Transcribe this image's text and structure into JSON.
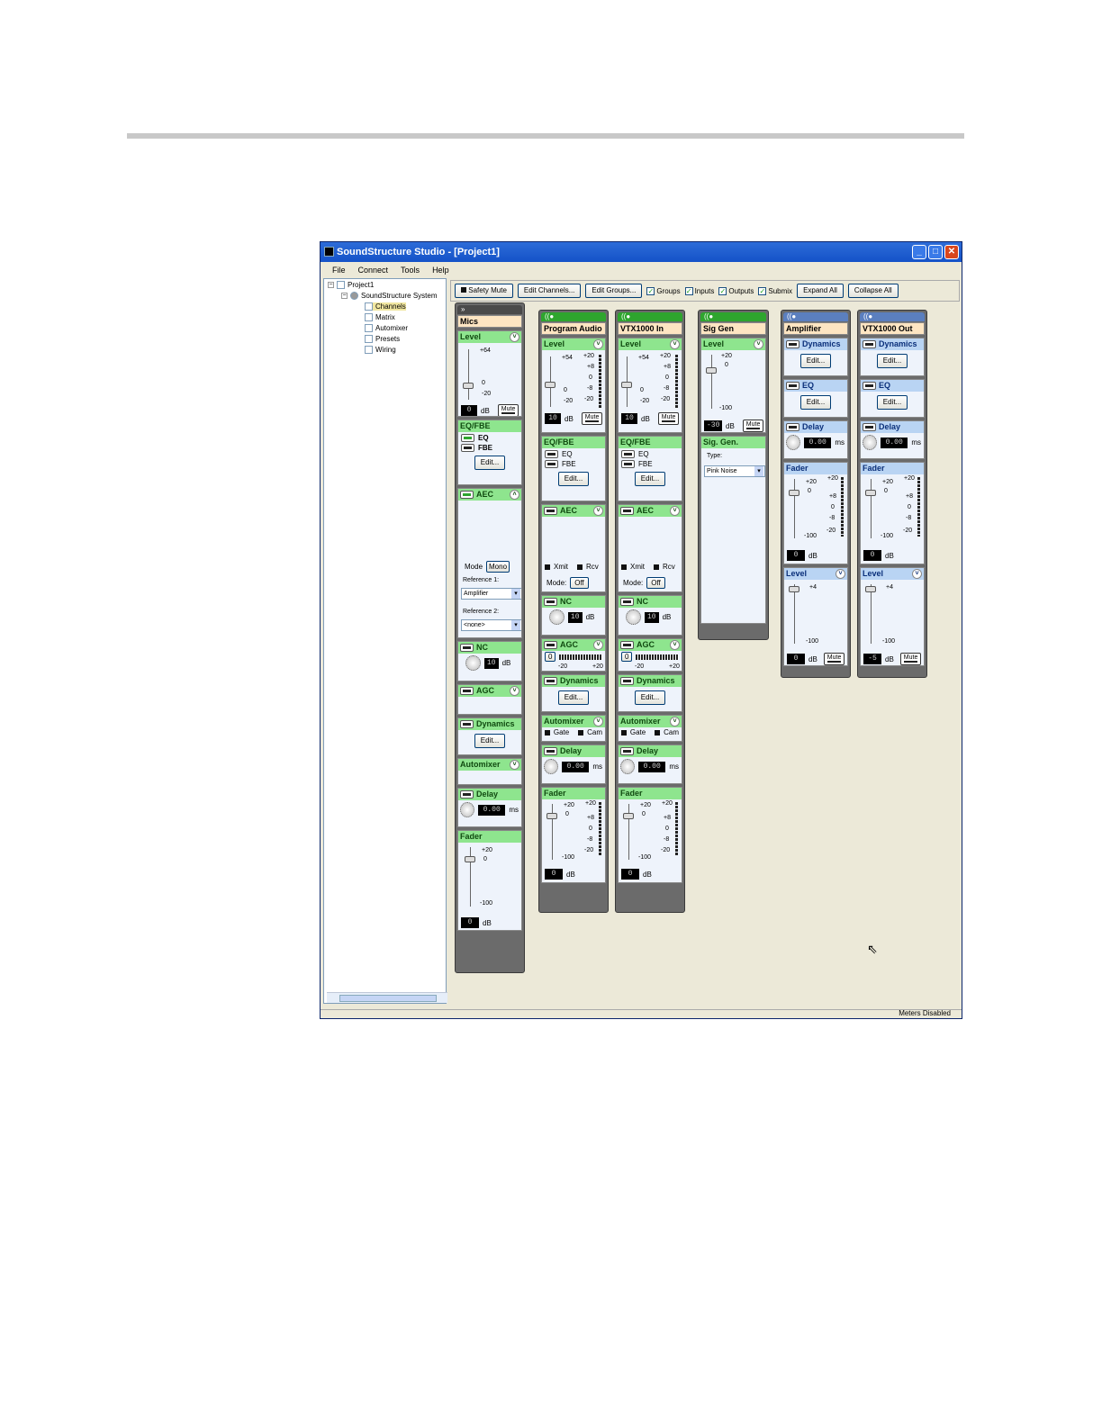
{
  "window": {
    "title": "SoundStructure Studio - [Project1]",
    "menu": [
      "File",
      "Connect",
      "Tools",
      "Help"
    ]
  },
  "tree": {
    "project": "Project1",
    "system": "SoundStructure System",
    "children": [
      "Channels",
      "Matrix",
      "Automixer",
      "Presets",
      "Wiring"
    ]
  },
  "toolbar": {
    "safety_mute": "Safety Mute",
    "edit_channels": "Edit Channels...",
    "edit_groups": "Edit Groups...",
    "checks": [
      "Groups",
      "Inputs",
      "Outputs",
      "Submix"
    ],
    "expand_all": "Expand All",
    "collapse_all": "Collapse All"
  },
  "status": "Meters Disabled",
  "common": {
    "db": "dB",
    "ms": "ms",
    "mute": "Mute",
    "edit": "Edit...",
    "level": "Level",
    "eqfbe": "EQ/FBE",
    "eq": "EQ",
    "fbe": "FBE",
    "aec": "AEC",
    "nc": "NC",
    "agc": "AGC",
    "dynamics": "Dynamics",
    "automixer": "Automixer",
    "delay": "Delay",
    "fader": "Fader",
    "xmit": "Xmit",
    "rcv": "Rcv",
    "gate": "Gate",
    "cam": "Cam",
    "mode": "Mode:",
    "off": "Off",
    "meter_ticks": [
      "+20",
      "+8",
      "0",
      "-8",
      "-20"
    ]
  },
  "mics": {
    "name": "Mics",
    "level": {
      "max": "+64",
      "zero": "0",
      "min": "-20",
      "value": "0"
    },
    "aec": {
      "mode_label": "Mode",
      "mode": "Mono",
      "ref1_label": "Reference 1:",
      "ref1": "Amplifier",
      "ref2_label": "Reference 2:",
      "ref2": "<none>"
    },
    "nc": "10",
    "delay": "0.00",
    "fader": {
      "max": "+20",
      "zero": "0",
      "min": "-100",
      "value": "0"
    }
  },
  "program": {
    "name": "Program Audio",
    "level": {
      "max": "+54",
      "zero": "0",
      "min": "-20",
      "value": "10"
    },
    "nc": "10",
    "agc": {
      "value": "0",
      "min": "-20",
      "max": "+20"
    },
    "delay": "0.00",
    "fader": {
      "max": "+20",
      "zero": "0",
      "min": "-100",
      "value": "0"
    }
  },
  "vtxin": {
    "name": "VTX1000 In",
    "level": {
      "max": "+54",
      "zero": "0",
      "min": "-20",
      "value": "10"
    },
    "nc": "10",
    "agc": {
      "value": "0",
      "min": "-20",
      "max": "+20"
    },
    "delay": "0.00",
    "fader": {
      "max": "+20",
      "zero": "0",
      "min": "-100",
      "value": "0"
    }
  },
  "siggen": {
    "name": "Sig Gen",
    "level": {
      "max": "+20",
      "zero": "0",
      "min": "-100",
      "value": "-30"
    },
    "block": "Sig. Gen.",
    "type_label": "Type:",
    "type": "Pink Noise"
  },
  "amp": {
    "name": "Amplifier",
    "delay": "0.00",
    "fader": {
      "max": "+20",
      "zero": "0",
      "min": "-100",
      "value": "0"
    },
    "level": {
      "max": "+4",
      "min": "-100",
      "value": "0"
    }
  },
  "vtxout": {
    "name": "VTX1000 Out",
    "delay": "0.00",
    "fader": {
      "max": "+20",
      "zero": "0",
      "min": "-100",
      "value": "0"
    },
    "level": {
      "max": "+4",
      "min": "-100",
      "value": "-5"
    }
  }
}
